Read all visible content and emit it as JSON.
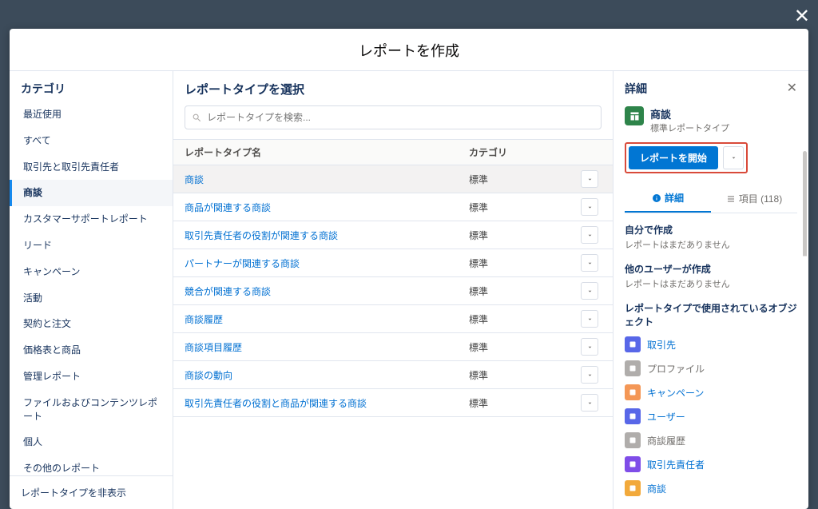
{
  "modal": {
    "title": "レポートを作成"
  },
  "sidebar": {
    "title": "カテゴリ",
    "items": [
      "最近使用",
      "すべて",
      "取引先と取引先責任者",
      "商談",
      "カスタマーサポートレポート",
      "リード",
      "キャンペーン",
      "活動",
      "契約と注文",
      "価格表と商品",
      "管理レポート",
      "ファイルおよびコンテンツレポート",
      "個人",
      "その他のレポート"
    ],
    "active_index": 3,
    "footer": "レポートタイプを非表示"
  },
  "main": {
    "title": "レポートタイプを選択",
    "search_placeholder": "レポートタイプを検索...",
    "columns": {
      "name": "レポートタイプ名",
      "category": "カテゴリ"
    },
    "rows": [
      {
        "name": "商談",
        "category": "標準",
        "selected": true
      },
      {
        "name": "商品が関連する商談",
        "category": "標準"
      },
      {
        "name": "取引先責任者の役割が関連する商談",
        "category": "標準"
      },
      {
        "name": "パートナーが関連する商談",
        "category": "標準"
      },
      {
        "name": "競合が関連する商談",
        "category": "標準"
      },
      {
        "name": "商談履歴",
        "category": "標準"
      },
      {
        "name": "商談項目履歴",
        "category": "標準"
      },
      {
        "name": "商談の動向",
        "category": "標準"
      },
      {
        "name": "取引先責任者の役割と商品が関連する商談",
        "category": "標準"
      }
    ]
  },
  "details": {
    "title": "詳細",
    "name": "商談",
    "subtitle": "標準レポートタイプ",
    "start_button": "レポートを開始",
    "tabs": {
      "detail": "詳細",
      "fields": "項目 (118)"
    },
    "sections": {
      "self_title": "自分で作成",
      "self_text": "レポートはまだありません",
      "others_title": "他のユーザーが作成",
      "others_text": "レポートはまだありません",
      "objects_title": "レポートタイプで使用されているオブジェクト"
    },
    "objects": [
      {
        "label": "取引先",
        "color": "#5867e8",
        "muted": false
      },
      {
        "label": "プロファイル",
        "color": "#b0adab",
        "muted": true
      },
      {
        "label": "キャンペーン",
        "color": "#f49756",
        "muted": false
      },
      {
        "label": "ユーザー",
        "color": "#5867e8",
        "muted": false
      },
      {
        "label": "商談履歴",
        "color": "#b0adab",
        "muted": true
      },
      {
        "label": "取引先責任者",
        "color": "#7f4de8",
        "muted": false
      },
      {
        "label": "商談",
        "color": "#f2a93b",
        "muted": false
      }
    ]
  }
}
